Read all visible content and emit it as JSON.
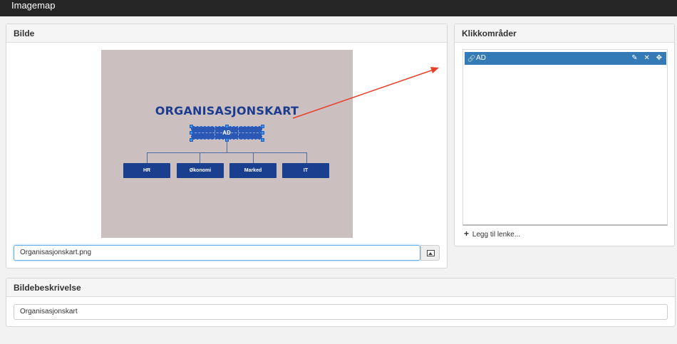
{
  "app": {
    "title": "Imagemap"
  },
  "image_panel": {
    "title": "Bilde",
    "chart": {
      "title": "ORGANISASJONSKART",
      "top_box": "AD",
      "children": [
        "HR",
        "Økonomi",
        "Marked",
        "IT"
      ]
    },
    "file_input": {
      "value": "Organisasjonskart.png"
    },
    "file_button_icon": "image-icon"
  },
  "areas_panel": {
    "title": "Klikkområder",
    "items": [
      {
        "label": "AD"
      }
    ],
    "icons": {
      "edit": "edit-icon",
      "delete": "close-icon",
      "move": "move-icon",
      "link": "link-icon"
    },
    "add_link_label": "Legg til lenke..."
  },
  "description_panel": {
    "title": "Bildebeskrivelse",
    "input_value": "Organisasjonskart"
  },
  "colors": {
    "accent": "#337ab7",
    "topbar": "#262626",
    "annotation_arrow": "#e8402a",
    "chart_blue": "#1b3f8f"
  }
}
